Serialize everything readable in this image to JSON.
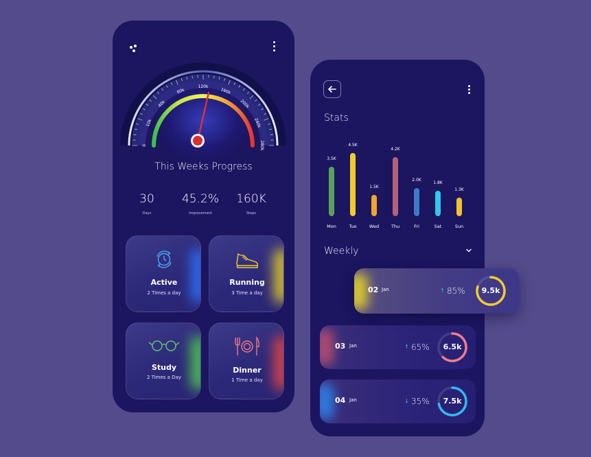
{
  "left_phone": {
    "gauge": {
      "ticks": [
        "0",
        "10k",
        "40k",
        "80k",
        "120k",
        "160k",
        "200k",
        "240k",
        "280k"
      ],
      "value_k": 160,
      "max_k": 280
    },
    "title": "This Weeks Progress",
    "stats": [
      {
        "value": "30",
        "label": "Days"
      },
      {
        "value": "45.2%",
        "label": "Improvement"
      },
      {
        "value": "160K",
        "label": "Steps"
      }
    ],
    "tiles": [
      {
        "name": "Active",
        "sub": "2 Times a day",
        "icon": "clock-refresh-icon",
        "accent": "#2f6cf0"
      },
      {
        "name": "Running",
        "sub": "3 Time a day",
        "icon": "running-shoe-icon",
        "accent": "#d6c332"
      },
      {
        "name": "Study",
        "sub": "2 Times a Day",
        "icon": "glasses-icon",
        "accent": "#4fbf55"
      },
      {
        "name": "Dinner",
        "sub": "1 Time a day",
        "icon": "fork-plate-knife-icon",
        "accent": "#d8444b"
      }
    ]
  },
  "right_phone": {
    "title": "Stats",
    "chart_data": {
      "type": "bar",
      "categories": [
        "Mon",
        "Tue",
        "Wed",
        "Thu",
        "Fri",
        "Sat",
        "Sun"
      ],
      "values": [
        3.5,
        4.5,
        1.5,
        4.2,
        2.0,
        1.8,
        1.3
      ],
      "value_labels": [
        "3.5K",
        "4.5K",
        "1.5K",
        "4.2K",
        "2.0K",
        "1.8K",
        "1.3K"
      ],
      "colors": [
        "#5aa05a",
        "#f2cc2e",
        "#f2a62b",
        "#b0637a",
        "#3f79c9",
        "#35c6ee",
        "#f1c12e"
      ],
      "ylim": [
        0,
        4.5
      ],
      "grid": false
    },
    "weekly_label": "Weekly",
    "rows": [
      {
        "day": "02",
        "month": "Jan",
        "trend": "up",
        "trend_color": "#35c6ee",
        "percent": "85%",
        "total": "9.5k",
        "fraction": 0.8,
        "ring_color": "#f2cc2e",
        "edge": "#d6c332"
      },
      {
        "day": "03",
        "month": "Jan",
        "trend": "up",
        "trend_color": "#35c6ee",
        "percent": "65%",
        "total": "6.5k",
        "fraction": 0.62,
        "ring_color": "#f17d8a",
        "edge": "#b04a70"
      },
      {
        "day": "04",
        "month": "Jan",
        "trend": "down",
        "trend_color": "#35c6ee",
        "percent": "35%",
        "total": "7.5k",
        "fraction": 0.72,
        "ring_color": "#35b8f2",
        "edge": "#2f7de0"
      }
    ]
  }
}
